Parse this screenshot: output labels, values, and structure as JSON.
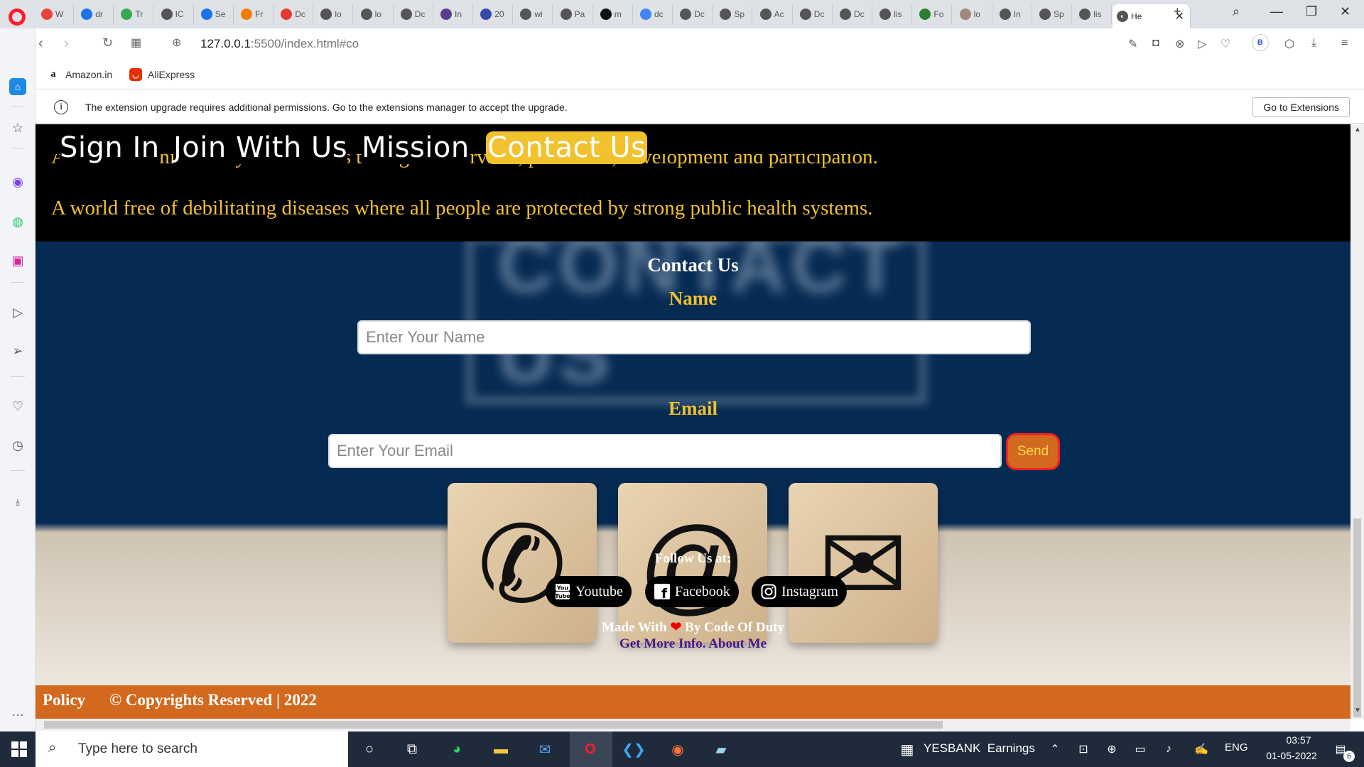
{
  "browser": {
    "tabs": [
      {
        "label": "W",
        "color": "#e8433a"
      },
      {
        "label": "dr",
        "color": "#1a73e8"
      },
      {
        "label": "Tr",
        "color": "#34a853"
      },
      {
        "label": "IC",
        "color": "#555555"
      },
      {
        "label": "Se",
        "color": "#1a73e8"
      },
      {
        "label": "Fr",
        "color": "#f57c00"
      },
      {
        "label": "Dc",
        "color": "#e53935"
      },
      {
        "label": "lo",
        "color": "#555555"
      },
      {
        "label": "lo",
        "color": "#555555"
      },
      {
        "label": "Dc",
        "color": "#555555"
      },
      {
        "label": "In",
        "color": "#5c3c8c"
      },
      {
        "label": "20",
        "color": "#3949ab"
      },
      {
        "label": "wi",
        "color": "#555555"
      },
      {
        "label": "Pa",
        "color": "#555555"
      },
      {
        "label": "m",
        "color": "#111111"
      },
      {
        "label": "dc",
        "color": "#4285f4"
      },
      {
        "label": "Dc",
        "color": "#555555"
      },
      {
        "label": "Sp",
        "color": "#555555"
      },
      {
        "label": "Ac",
        "color": "#555555"
      },
      {
        "label": "Dc",
        "color": "#555555"
      },
      {
        "label": "Dc",
        "color": "#555555"
      },
      {
        "label": "lis",
        "color": "#555555"
      },
      {
        "label": "Fo",
        "color": "#2e7d32"
      },
      {
        "label": "lo",
        "color": "#a1887f"
      },
      {
        "label": "In",
        "color": "#555555"
      },
      {
        "label": "Sp",
        "color": "#555555"
      },
      {
        "label": "lis",
        "color": "#555555"
      }
    ],
    "active_tab": "He",
    "url_host": "127.0.0.1",
    "url_rest": ":5500/index.html#co",
    "bookmarks": [
      {
        "label": "Amazon.in"
      },
      {
        "label": "AliExpress"
      }
    ],
    "info_message": "The extension upgrade requires additional permissions. Go to the extensions manager to accept the upgrade.",
    "extensions_button": "Go to Extensions",
    "profile_initial": "B"
  },
  "site": {
    "nav": [
      "Sign In",
      "Join With Us",
      "Mission",
      "Contact Us"
    ],
    "vision_line_clipped": "A world in which every child attains the right to survival, protection, development and participation.",
    "vision_line": "A world free of debilitating diseases where all people are protected by strong public health systems.",
    "contact": {
      "heading": "Contact Us",
      "name_label": "Name",
      "name_placeholder": "Enter Your Name",
      "email_label": "Email",
      "email_placeholder": "Enter Your Email",
      "send": "Send"
    },
    "follow": "Follow Us at:",
    "social": [
      "Youtube",
      "Facebook",
      "Instagram"
    ],
    "made_with_prefix": "Made With",
    "made_with_suffix": "By Code Of Duty",
    "more_info": "Get More Info. About Me",
    "footer_policy": "Policy",
    "footer_copyright": "© Copyrights Reserved | 2022"
  },
  "taskbar": {
    "search_placeholder": "Type here to search",
    "stock": "YESBANK",
    "stock_status": "Earnings",
    "lang": "ENG",
    "time": "03:57",
    "date": "01-05-2022",
    "notifications": "6"
  },
  "colors": {
    "accent_yellow": "#f2c12e",
    "footer_orange": "#d2691e",
    "page_navy": "#062b53"
  }
}
